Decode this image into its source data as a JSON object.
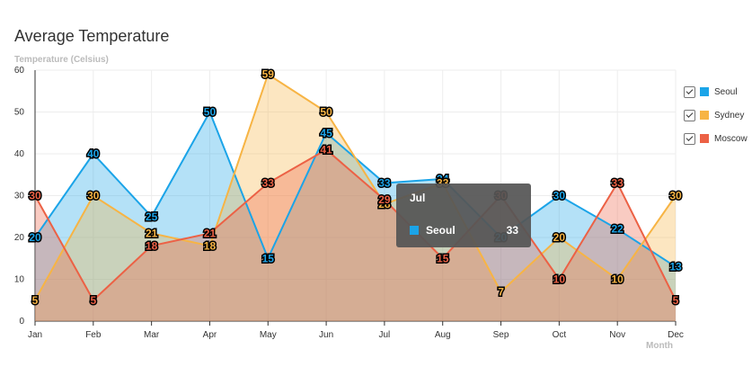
{
  "chart_data": {
    "type": "area",
    "title": "Average Temperature",
    "ylabel": "Temperature (Celsius)",
    "xlabel": "Month",
    "categories": [
      "Jan",
      "Feb",
      "Mar",
      "Apr",
      "May",
      "Jun",
      "Jul",
      "Aug",
      "Sep",
      "Oct",
      "Nov",
      "Dec"
    ],
    "ylim": [
      0,
      60
    ],
    "yticks": [
      0,
      10,
      20,
      30,
      40,
      50,
      60
    ],
    "grid": true,
    "legend_position": "right",
    "series": [
      {
        "name": "Seoul",
        "color": "#1ba4e8",
        "fill": "rgba(27,164,232,0.33)",
        "values": [
          20,
          40,
          25,
          50,
          15,
          45,
          33,
          34,
          20,
          30,
          22,
          13
        ]
      },
      {
        "name": "Sydney",
        "color": "#f7b444",
        "fill": "rgba(247,180,68,0.33)",
        "values": [
          5,
          30,
          21,
          18,
          59,
          50,
          28,
          33,
          7,
          20,
          10,
          30
        ]
      },
      {
        "name": "Moscow",
        "color": "#ec6145",
        "fill": "rgba(236,97,69,0.33)",
        "values": [
          30,
          5,
          18,
          21,
          33,
          41,
          29,
          15,
          30,
          10,
          33,
          5
        ]
      }
    ]
  },
  "tooltip": {
    "title": "Jul",
    "series_name": "Seoul",
    "value": "33",
    "color": "#1ba4e8"
  }
}
